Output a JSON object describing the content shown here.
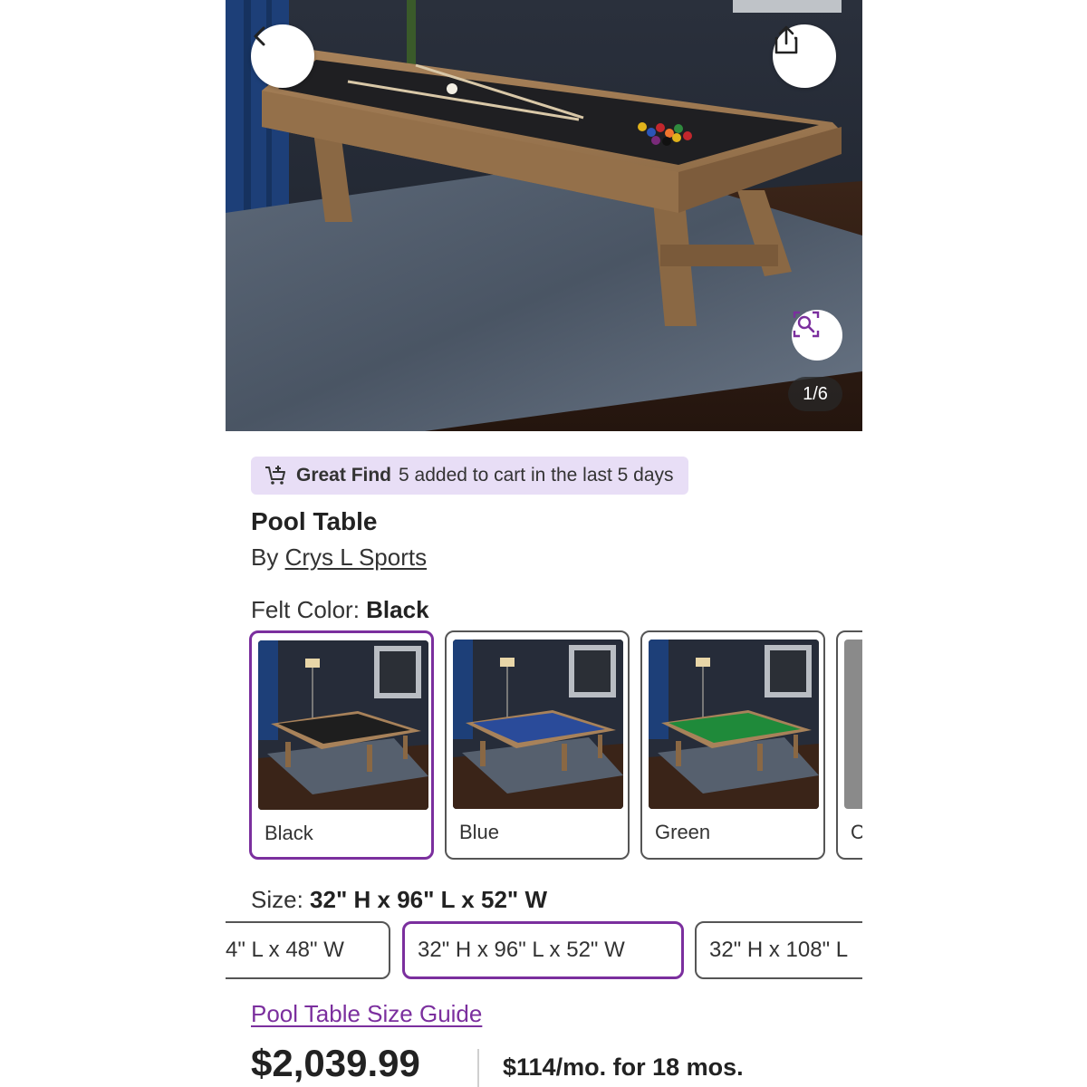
{
  "hero": {
    "counter": "1/6"
  },
  "badge": {
    "bold": "Great Find",
    "text": "5 added to cart in the last 5 days",
    "color": "#e8def6"
  },
  "product": {
    "title": "Pool Table",
    "by_prefix": "By",
    "brand": "Crys L Sports"
  },
  "felt": {
    "label": "Felt Color:",
    "selected": "Black",
    "options": [
      {
        "label": "Black",
        "felt_color": "#1e1e1e"
      },
      {
        "label": "Blue",
        "felt_color": "#2a4b9a"
      },
      {
        "label": "Green",
        "felt_color": "#1f8a3a"
      },
      {
        "label": "C",
        "felt_color": "#8a8a8a"
      }
    ]
  },
  "size": {
    "label": "Size:",
    "selected": "32\" H x 96\" L x 52\" W",
    "options": [
      "4\" L x 48\" W",
      "32\" H x 96\" L x 52\" W",
      "32\" H x 108\" L"
    ]
  },
  "guide_link": "Pool Table Size Guide",
  "pricing": {
    "price": "$2,039.99",
    "monthly": "$114/mo. for 18 mos."
  },
  "colors": {
    "accent": "#7b2f9e",
    "badge_bg": "#e8def6"
  },
  "icons": [
    "chevron-left-icon",
    "share-icon",
    "zoom-icon",
    "cart-add-icon"
  ]
}
